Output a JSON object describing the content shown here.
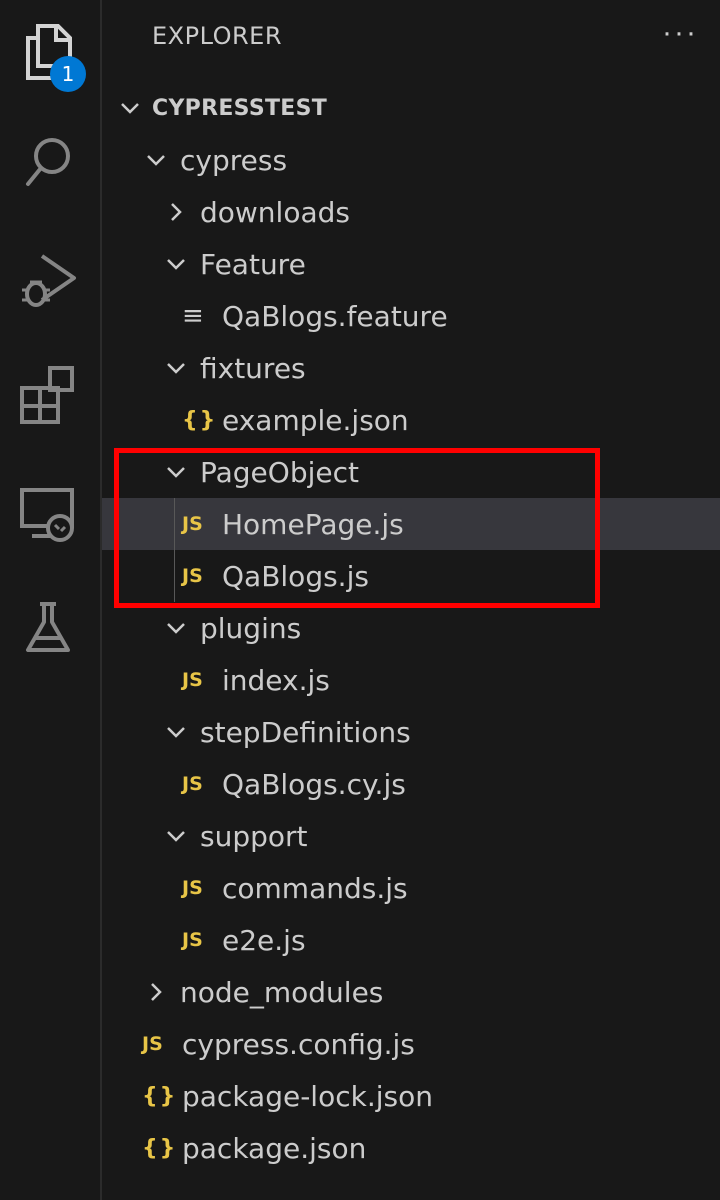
{
  "activity_bar": {
    "explorer_badge": "1",
    "icons": [
      "explorer-icon",
      "search-icon",
      "run-debug-icon",
      "extensions-icon",
      "remote-explorer-icon",
      "testing-icon"
    ]
  },
  "sidebar": {
    "title": "EXPLORER",
    "more_actions": "···",
    "root_label": "CYPRESSTEST"
  },
  "tree": [
    {
      "label": "cypress",
      "kind": "folder",
      "expanded": true
    },
    {
      "label": "downloads",
      "kind": "folder",
      "expanded": false
    },
    {
      "label": "Feature",
      "kind": "folder",
      "expanded": true
    },
    {
      "label": "QaBlogs.feature",
      "kind": "feature"
    },
    {
      "label": "fixtures",
      "kind": "folder",
      "expanded": true
    },
    {
      "label": "example.json",
      "kind": "json"
    },
    {
      "label": "PageObject",
      "kind": "folder",
      "expanded": true
    },
    {
      "label": "HomePage.js",
      "kind": "js",
      "selected": true
    },
    {
      "label": "QaBlogs.js",
      "kind": "js"
    },
    {
      "label": "plugins",
      "kind": "folder",
      "expanded": true
    },
    {
      "label": "index.js",
      "kind": "js"
    },
    {
      "label": "stepDefinitions",
      "kind": "folder",
      "expanded": true
    },
    {
      "label": "QaBlogs.cy.js",
      "kind": "js"
    },
    {
      "label": "support",
      "kind": "folder",
      "expanded": true
    },
    {
      "label": "commands.js",
      "kind": "js"
    },
    {
      "label": "e2e.js",
      "kind": "js"
    },
    {
      "label": "node_modules",
      "kind": "folder",
      "expanded": false
    },
    {
      "label": "cypress.config.js",
      "kind": "js"
    },
    {
      "label": "package-lock.json",
      "kind": "json"
    },
    {
      "label": "package.json",
      "kind": "json"
    }
  ],
  "icon_glyphs": {
    "js": "JS",
    "json": "{}",
    "feature": "≡"
  },
  "colors": {
    "background": "#181818",
    "text": "#cccccc",
    "selected_row": "#37373d",
    "file_icon_yellow": "#e8c547",
    "badge_blue": "#0078d4",
    "annotation_red": "#ff0000"
  }
}
